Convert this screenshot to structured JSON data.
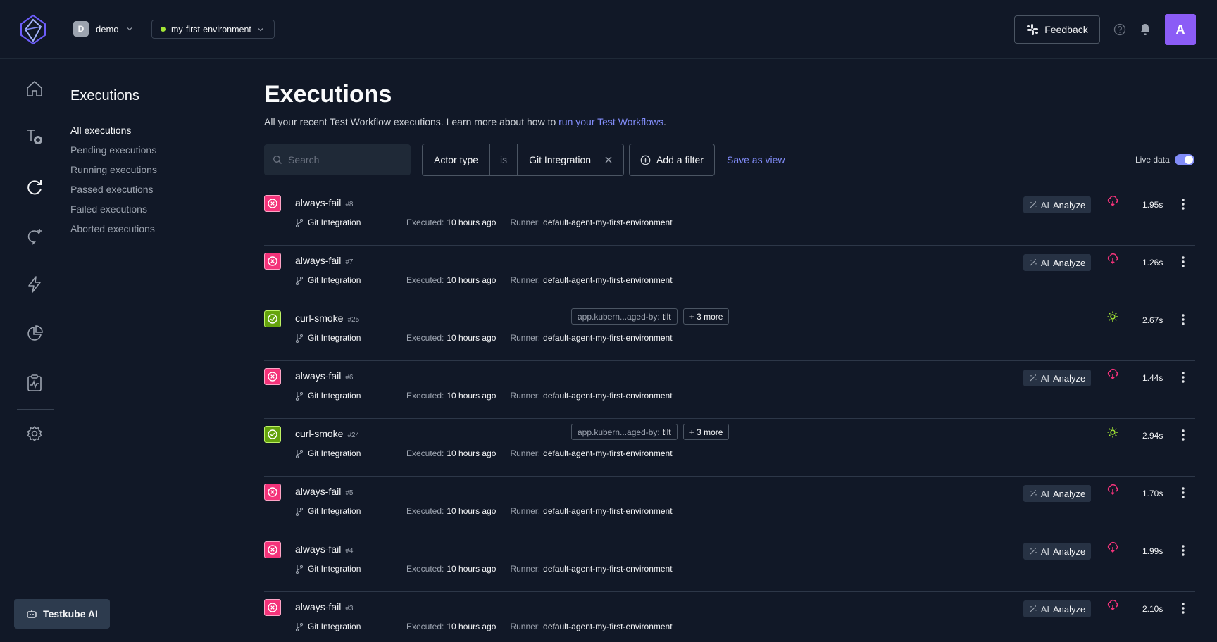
{
  "header": {
    "org": {
      "initial": "D",
      "name": "demo"
    },
    "environment": {
      "name": "my-first-environment",
      "status_color": "#a3e635"
    },
    "feedback_label": "Feedback",
    "user_initial": "A"
  },
  "rail": {
    "items": [
      {
        "icon": "home-icon"
      },
      {
        "icon": "add-workflow-icon"
      },
      {
        "icon": "executions-icon",
        "active": true
      },
      {
        "icon": "triggers-icon"
      },
      {
        "icon": "lightning-icon"
      },
      {
        "icon": "pie-chart-icon"
      },
      {
        "icon": "test-report-icon"
      },
      {
        "icon": "gear-icon"
      }
    ],
    "ai_button_label": "Testkube AI"
  },
  "subnav": {
    "title": "Executions",
    "items": [
      "All executions",
      "Pending executions",
      "Running executions",
      "Passed executions",
      "Failed executions",
      "Aborted executions"
    ],
    "active_index": 0
  },
  "main": {
    "title": "Executions",
    "description_prefix": "All your recent Test Workflow executions. Learn more about how to ",
    "description_link": "run your Test Workflows",
    "description_suffix": ".",
    "search_placeholder": "Search",
    "filter": {
      "field": "Actor type",
      "operator": "is",
      "value": "Git Integration"
    },
    "add_filter_label": "Add a filter",
    "save_view_label": "Save as view",
    "live_data_label": "Live data",
    "live_data_on": true,
    "analyze_ai": "AI",
    "analyze_label": "Analyze",
    "meta_labels": {
      "executed": "Executed:",
      "runner": "Runner:"
    }
  },
  "colors": {
    "accent": "#818cf8",
    "failed": "#f4337a",
    "passed": "#65a30d",
    "background": "#111827"
  },
  "executions": [
    {
      "name": "always-fail",
      "number": "#8",
      "status": "failed",
      "actor": "Git Integration",
      "executed": "10 hours ago",
      "runner": "default-agent-my-first-environment",
      "duration": "1.95s",
      "trigger": "cloud-trigger-icon",
      "analyze": true
    },
    {
      "name": "always-fail",
      "number": "#7",
      "status": "failed",
      "actor": "Git Integration",
      "executed": "10 hours ago",
      "runner": "default-agent-my-first-environment",
      "duration": "1.26s",
      "trigger": "cloud-trigger-icon",
      "analyze": true
    },
    {
      "name": "curl-smoke",
      "number": "#25",
      "status": "passed",
      "actor": "Git Integration",
      "executed": "10 hours ago",
      "runner": "default-agent-my-first-environment",
      "duration": "2.67s",
      "trigger": "sun-trigger-icon",
      "analyze": false,
      "label_key": "app.kubern...aged-by:",
      "label_value": "tilt",
      "label_more": "+ 3 more"
    },
    {
      "name": "always-fail",
      "number": "#6",
      "status": "failed",
      "actor": "Git Integration",
      "executed": "10 hours ago",
      "runner": "default-agent-my-first-environment",
      "duration": "1.44s",
      "trigger": "cloud-trigger-icon",
      "analyze": true
    },
    {
      "name": "curl-smoke",
      "number": "#24",
      "status": "passed",
      "actor": "Git Integration",
      "executed": "10 hours ago",
      "runner": "default-agent-my-first-environment",
      "duration": "2.94s",
      "trigger": "sun-trigger-icon",
      "analyze": false,
      "label_key": "app.kubern...aged-by:",
      "label_value": "tilt",
      "label_more": "+ 3 more"
    },
    {
      "name": "always-fail",
      "number": "#5",
      "status": "failed",
      "actor": "Git Integration",
      "executed": "10 hours ago",
      "runner": "default-agent-my-first-environment",
      "duration": "1.70s",
      "trigger": "cloud-trigger-icon",
      "analyze": true
    },
    {
      "name": "always-fail",
      "number": "#4",
      "status": "failed",
      "actor": "Git Integration",
      "executed": "10 hours ago",
      "runner": "default-agent-my-first-environment",
      "duration": "1.99s",
      "trigger": "cloud-trigger-icon",
      "analyze": true
    },
    {
      "name": "always-fail",
      "number": "#3",
      "status": "failed",
      "actor": "Git Integration",
      "executed": "10 hours ago",
      "runner": "default-agent-my-first-environment",
      "duration": "2.10s",
      "trigger": "cloud-trigger-icon",
      "analyze": true
    }
  ]
}
